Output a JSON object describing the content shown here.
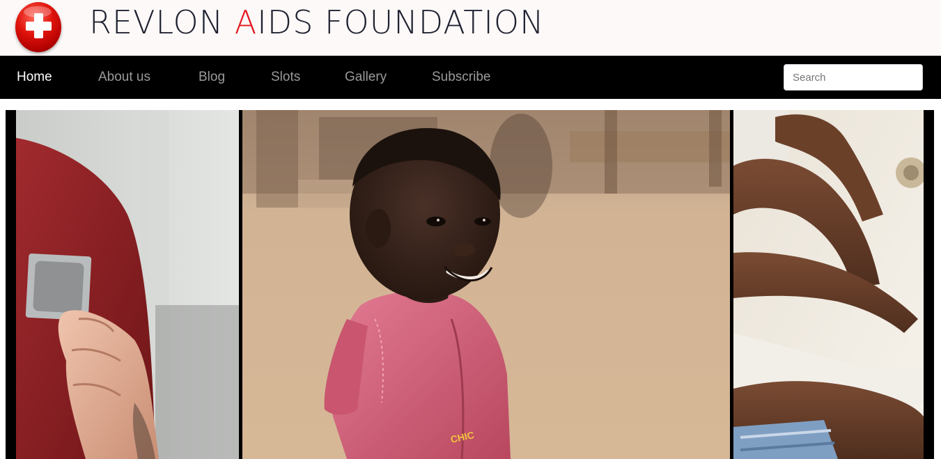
{
  "header": {
    "title_parts": [
      "REVLON ",
      "A",
      "IDS FOUNDATION"
    ],
    "logo_icon": "red-cross-logo-icon"
  },
  "nav": {
    "items": [
      {
        "label": "Home",
        "active": true
      },
      {
        "label": "About us",
        "active": false
      },
      {
        "label": "Blog",
        "active": false
      },
      {
        "label": "Slots",
        "active": false
      },
      {
        "label": "Gallery",
        "active": false
      },
      {
        "label": "Subscribe",
        "active": false
      }
    ],
    "search_placeholder": "Search"
  },
  "hero": {
    "shirt_text": "CHIC"
  },
  "colors": {
    "accent": "#e4161e",
    "nav_bg": "#000000",
    "nav_text": "#9a9a9a",
    "nav_active": "#ffffff",
    "header_bg": "#fdf9f8"
  }
}
